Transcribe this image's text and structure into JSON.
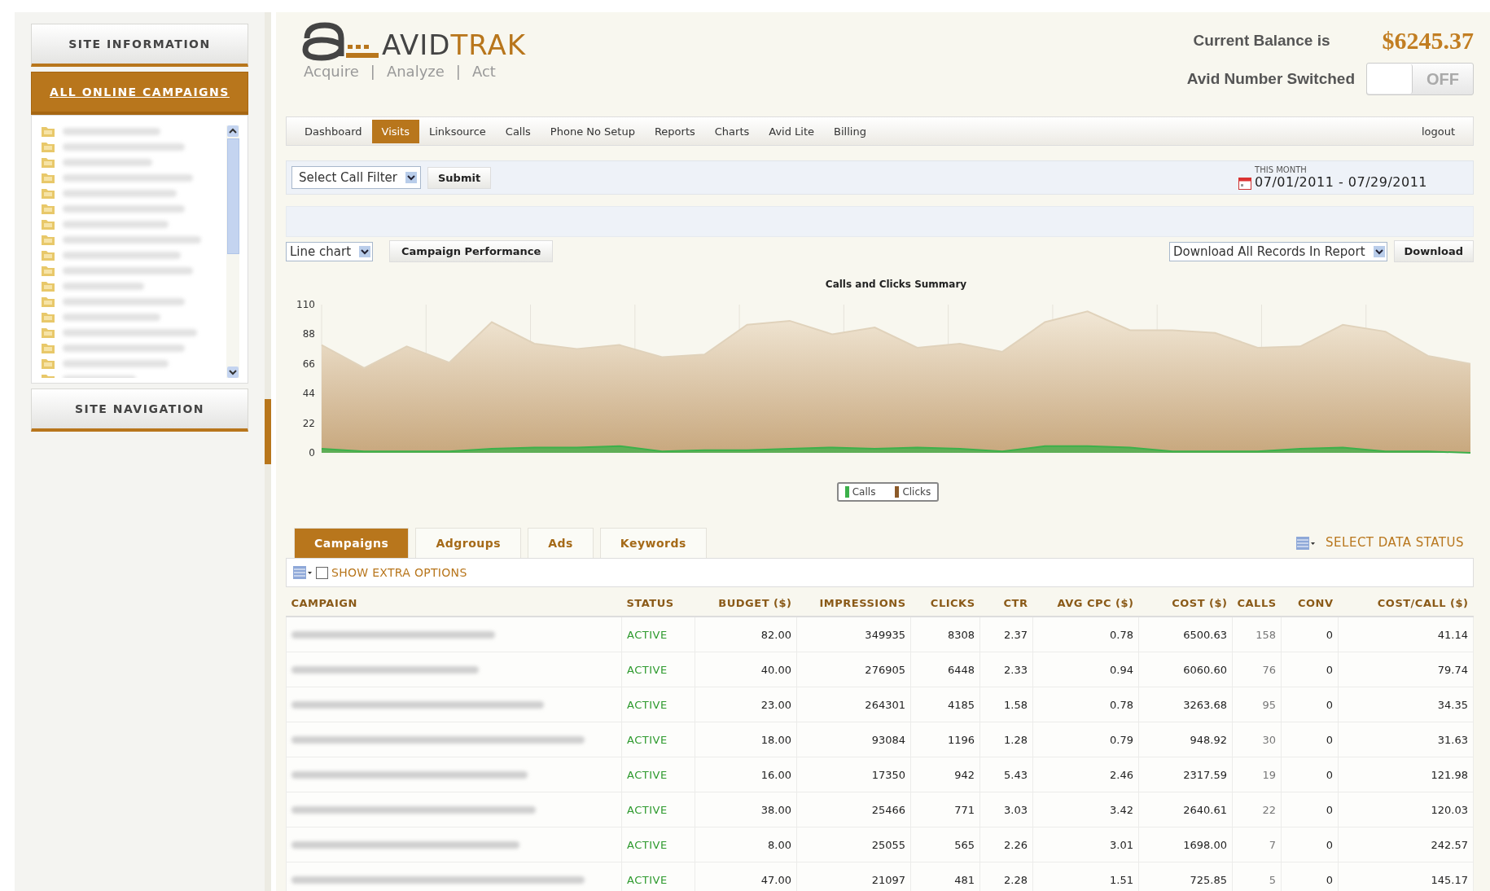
{
  "sidebar": {
    "panels": [
      {
        "label": "SITE INFORMATION",
        "selected": false
      },
      {
        "label": "ALL ONLINE CAMPAIGNS",
        "selected": true
      }
    ],
    "footer_panel": {
      "label": "SITE NAVIGATION",
      "selected": false
    }
  },
  "header": {
    "wordmark": [
      "AVID",
      "TRAK"
    ],
    "tagline": [
      "Acquire",
      "|",
      "Analyze",
      "|",
      "Act"
    ],
    "balance": {
      "label": "Current Balance is",
      "amount": "$6245.37"
    },
    "avid_number": {
      "label": "Avid Number Switched",
      "on": false,
      "state_label": "OFF"
    }
  },
  "nav": {
    "items": [
      {
        "label": "Dashboard",
        "selected": false
      },
      {
        "label": "Visits",
        "selected": true
      },
      {
        "label": "Linksource",
        "selected": false
      },
      {
        "label": "Calls",
        "selected": false
      },
      {
        "label": "Phone No Setup",
        "selected": false
      },
      {
        "label": "Reports",
        "selected": false
      },
      {
        "label": "Charts",
        "selected": false
      },
      {
        "label": "Avid Lite",
        "selected": false
      },
      {
        "label": "Billing",
        "selected": false
      }
    ],
    "logout": "logout"
  },
  "filter": {
    "select": "Select Call Filter",
    "submit": "Submit",
    "date_caption": "THIS MONTH",
    "date_range": "07/01/2011 - 07/29/2011"
  },
  "chart_controls": {
    "chart_type": "Line chart",
    "report": "Campaign Performance",
    "download_select": "Download All Records In Report",
    "download": "Download"
  },
  "chart": {
    "chart_data": {
      "type": "area",
      "title": "Calls and Clicks Summary",
      "legend": true,
      "grid": true,
      "ylim": [
        0,
        110
      ],
      "yticks": [
        0,
        22,
        44,
        66,
        88,
        110
      ],
      "series": [
        {
          "name": "Calls",
          "color": "#3cb04a",
          "values": [
            3,
            1,
            1,
            1,
            3,
            4,
            4,
            5,
            1,
            2,
            2,
            3,
            4,
            3,
            4,
            3,
            1,
            5,
            5,
            4,
            1,
            1,
            1,
            3,
            4,
            1,
            1,
            0
          ]
        },
        {
          "name": "Clicks",
          "color": "#8c5a28",
          "values": [
            80,
            63,
            79,
            67,
            97,
            81,
            77,
            80,
            71,
            73,
            95,
            98,
            88,
            93,
            78,
            81,
            75,
            97,
            105,
            91,
            91,
            89,
            78,
            79,
            95,
            90,
            72,
            66
          ]
        }
      ]
    }
  },
  "tabs": [
    {
      "label": "Campaigns",
      "selected": true
    },
    {
      "label": "Adgroups",
      "selected": false
    },
    {
      "label": "Ads",
      "selected": false
    },
    {
      "label": "Keywords",
      "selected": false
    }
  ],
  "data_status": "SELECT DATA STATUS",
  "extra_options": {
    "label": "SHOW EXTRA OPTIONS",
    "checked": false
  },
  "table": {
    "columns": [
      "CAMPAIGN",
      "STATUS",
      "BUDGET ($)",
      "IMPRESSIONS",
      "CLICKS",
      "CTR",
      "AVG CPC ($)",
      "COST ($)",
      "CALLS",
      "CONV",
      "COST/CALL ($)"
    ],
    "rows": [
      {
        "cells": [
          "",
          "ACTIVE",
          "82.00",
          "349935",
          "8308",
          "2.37",
          "0.78",
          "6500.63",
          "158",
          "0",
          "41.14"
        ]
      },
      {
        "cells": [
          "",
          "ACTIVE",
          "40.00",
          "276905",
          "6448",
          "2.33",
          "0.94",
          "6060.60",
          "76",
          "0",
          "79.74"
        ]
      },
      {
        "cells": [
          "",
          "ACTIVE",
          "23.00",
          "264301",
          "4185",
          "1.58",
          "0.78",
          "3263.68",
          "95",
          "0",
          "34.35"
        ]
      },
      {
        "cells": [
          "",
          "ACTIVE",
          "18.00",
          "93084",
          "1196",
          "1.28",
          "0.79",
          "948.92",
          "30",
          "0",
          "31.63"
        ]
      },
      {
        "cells": [
          "",
          "ACTIVE",
          "16.00",
          "17350",
          "942",
          "5.43",
          "2.46",
          "2317.59",
          "19",
          "0",
          "121.98"
        ]
      },
      {
        "cells": [
          "",
          "ACTIVE",
          "38.00",
          "25466",
          "771",
          "3.03",
          "3.42",
          "2640.61",
          "22",
          "0",
          "120.03"
        ]
      },
      {
        "cells": [
          "",
          "ACTIVE",
          "8.00",
          "25055",
          "565",
          "2.26",
          "3.01",
          "1698.00",
          "7",
          "0",
          "242.57"
        ]
      },
      {
        "cells": [
          "",
          "ACTIVE",
          "47.00",
          "21097",
          "481",
          "2.28",
          "1.51",
          "725.85",
          "5",
          "0",
          "145.17"
        ]
      }
    ]
  }
}
